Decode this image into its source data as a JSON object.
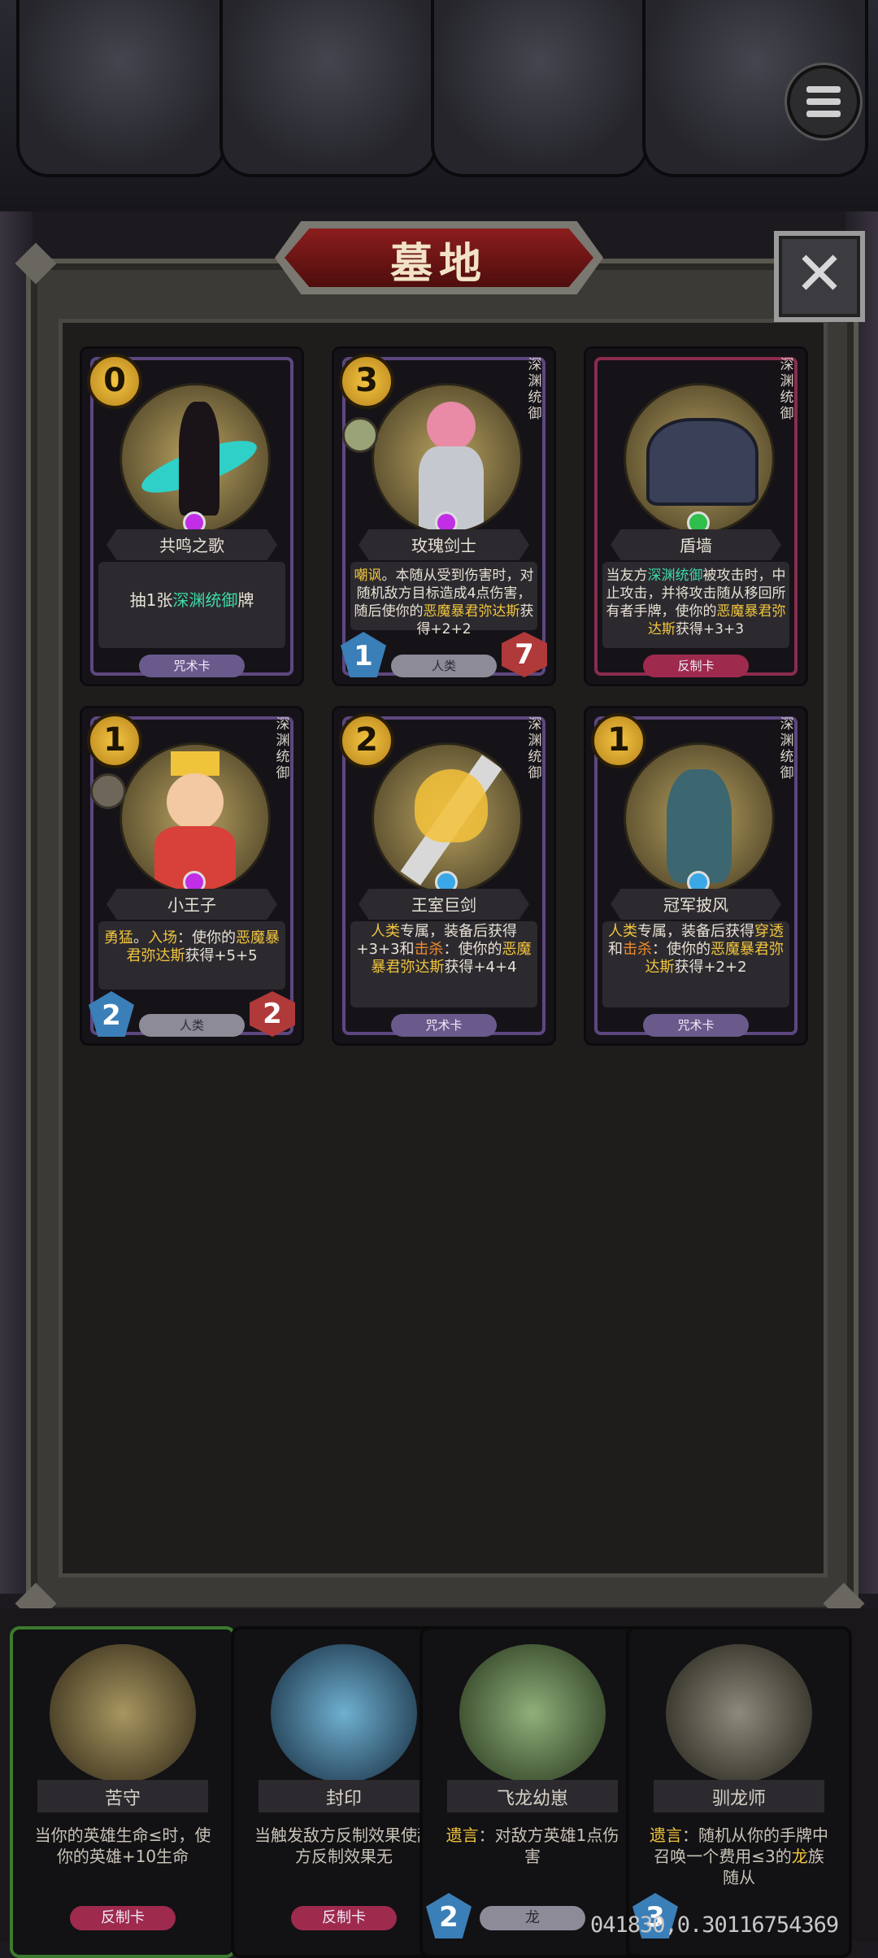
{
  "title": "墓地",
  "close_label": "✕",
  "cards": [
    {
      "cost": "0",
      "name": "共鸣之歌",
      "faction": "",
      "desc_pre": "抽1张",
      "desc_hl": "深渊统御",
      "desc_post": "牌",
      "type": "咒术卡"
    },
    {
      "cost": "3",
      "name": "玫瑰剑士",
      "faction": "深渊统御",
      "desc_hl1": "嘲讽",
      "desc_mid": "。本随从受到伤害时，对随机敌方目标造成4点伤害，随后使你的",
      "desc_hl2": "恶魔暴君弥达斯",
      "desc_post": "获得+2+2",
      "type": "人类",
      "attack": "1",
      "health": "7"
    },
    {
      "cost": "",
      "name": "盾墙",
      "faction": "深渊统御",
      "desc_pre": "当友方",
      "desc_hl1": "深渊统御",
      "desc_mid": "被攻击时，中止攻击，并将攻击随从移回所有者手牌，使你的",
      "desc_hl2": "恶魔暴君弥达斯",
      "desc_post": "获得+3+3",
      "type": "反制卡"
    },
    {
      "cost": "1",
      "name": "小王子",
      "faction": "深渊统御",
      "desc_hl1": "勇猛",
      "desc_sep": "。",
      "desc_hl2": "入场",
      "desc_mid": "：使你的",
      "desc_hl3": "恶魔暴君弥达斯",
      "desc_post": "获得+5+5",
      "type": "人类",
      "attack": "2",
      "health": "2"
    },
    {
      "cost": "2",
      "name": "王室巨剑",
      "faction": "深渊统御",
      "desc_hl1": "人类",
      "desc_mid1": "专属，装备后获得+3+3和",
      "desc_hl2": "击杀",
      "desc_mid2": "：使你的",
      "desc_hl3": "恶魔暴君弥达斯",
      "desc_post": "获得+4+4",
      "type": "咒术卡"
    },
    {
      "cost": "1",
      "name": "冠军披风",
      "faction": "深渊统御",
      "desc_hl1": "人类",
      "desc_mid1": "专属，装备后获得",
      "desc_hl2": "穿透",
      "desc_mid2": "和",
      "desc_hl3": "击杀",
      "desc_mid3": "：使你的",
      "desc_hl4": "恶魔暴君弥达斯",
      "desc_post": "获得+2+2",
      "type": "咒术卡"
    }
  ],
  "hand": [
    {
      "name": "苦守",
      "desc": "当你的英雄生命≤时，使你的英雄+10生命",
      "type": "反制卡"
    },
    {
      "name": "封印",
      "desc": "当触发敌方反制效果使敌方反制效果无",
      "type": "反制卡"
    },
    {
      "name": "飞龙幼崽",
      "desc_hl": "遗言",
      "desc": "：对敌方英雄1点伤害",
      "type": "龙",
      "attack": "2"
    },
    {
      "name": "驯龙师",
      "desc_hl": "遗言",
      "desc_pre": "：随机从你的手牌中召唤一个费用≤3的",
      "desc_hl2": "龙",
      "desc_post": "族随从",
      "attack": "3"
    }
  ],
  "debug_text": "041830,0.30116754369",
  "colors": {
    "accent_yellow": "#f2c53d",
    "accent_green": "#3fd8a7",
    "banner_red": "#8c1d1d"
  }
}
